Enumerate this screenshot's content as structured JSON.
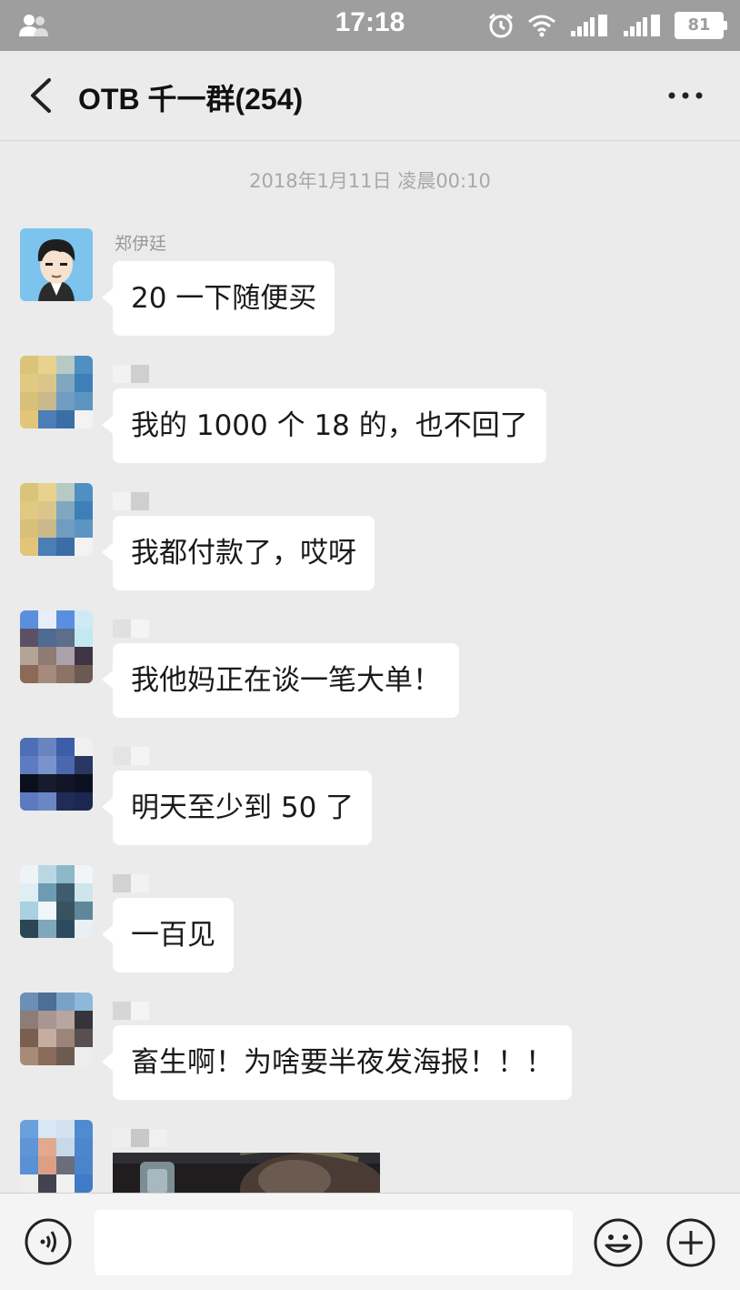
{
  "status_bar": {
    "time": "17:18",
    "battery": "81",
    "icons": [
      "user-icon",
      "alarm-icon",
      "wifi-icon",
      "signal-2-icon",
      "signal-1-icon",
      "battery-icon"
    ]
  },
  "header": {
    "title": "OTB 千一群(254)",
    "back_icon": "back-chevron-icon",
    "more_icon": "more-dots-icon"
  },
  "chat": {
    "timestamp": "2018年1月11日 凌晨00:10",
    "messages": [
      {
        "sender": "郑伊廷",
        "text": "20 一下随便买",
        "avatar": "cartoon-avatar"
      },
      {
        "sender": "",
        "text": "我的 1000 个 18 的，也不回了",
        "avatar": "blurred-avatar"
      },
      {
        "sender": "",
        "text": "我都付款了，哎呀",
        "avatar": "blurred-avatar"
      },
      {
        "sender": "",
        "text": "我他妈正在谈一笔大单！",
        "avatar": "blurred-avatar"
      },
      {
        "sender": "",
        "text": "明天至少到 50 了",
        "avatar": "blurred-avatar"
      },
      {
        "sender": "",
        "text": "一百见",
        "avatar": "blurred-avatar"
      },
      {
        "sender": "",
        "text": "畜生啊！为啥要半夜发海报！！！",
        "avatar": "blurred-avatar"
      },
      {
        "sender": "",
        "text": "",
        "avatar": "blurred-avatar",
        "content": "image"
      }
    ]
  },
  "input_bar": {
    "placeholder": "",
    "voice_icon": "voice-icon",
    "emoji_icon": "emoji-icon",
    "plus_icon": "plus-icon"
  },
  "colors": {
    "status_bar": "#9e9e9e",
    "background": "#ebebeb",
    "bubble": "#ffffff",
    "timestamp": "#a8a8a8"
  }
}
